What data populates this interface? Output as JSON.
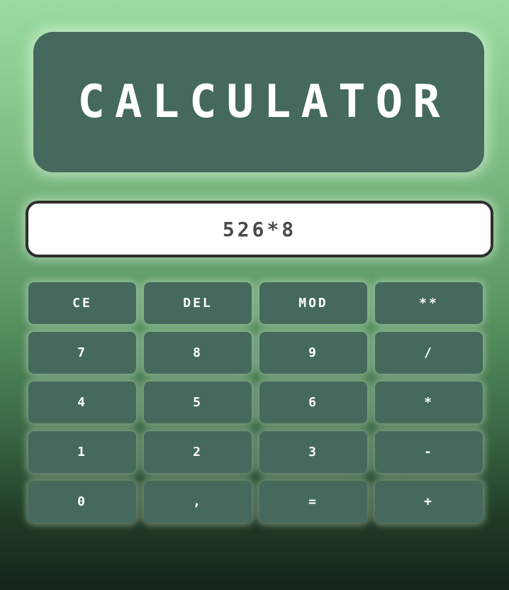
{
  "title": "CALCULATOR",
  "display": {
    "value": "526*8"
  },
  "keys": [
    {
      "label": "CE",
      "name": "clear-entry-button"
    },
    {
      "label": "DEL",
      "name": "delete-button"
    },
    {
      "label": "MOD",
      "name": "modulo-button"
    },
    {
      "label": "**",
      "name": "power-button"
    },
    {
      "label": "7",
      "name": "digit-7-button"
    },
    {
      "label": "8",
      "name": "digit-8-button"
    },
    {
      "label": "9",
      "name": "digit-9-button"
    },
    {
      "label": "/",
      "name": "divide-button"
    },
    {
      "label": "4",
      "name": "digit-4-button"
    },
    {
      "label": "5",
      "name": "digit-5-button"
    },
    {
      "label": "6",
      "name": "digit-6-button"
    },
    {
      "label": "*",
      "name": "multiply-button"
    },
    {
      "label": "1",
      "name": "digit-1-button"
    },
    {
      "label": "2",
      "name": "digit-2-button"
    },
    {
      "label": "3",
      "name": "digit-3-button"
    },
    {
      "label": "-",
      "name": "subtract-button"
    },
    {
      "label": "0",
      "name": "digit-0-button"
    },
    {
      "label": ",",
      "name": "decimal-button"
    },
    {
      "label": "=",
      "name": "equals-button"
    },
    {
      "label": "+",
      "name": "add-button"
    }
  ],
  "colors": {
    "panel": "#46695d",
    "text": "#ffffff",
    "display_bg": "#ffffff",
    "display_text": "#4a4a4a"
  }
}
